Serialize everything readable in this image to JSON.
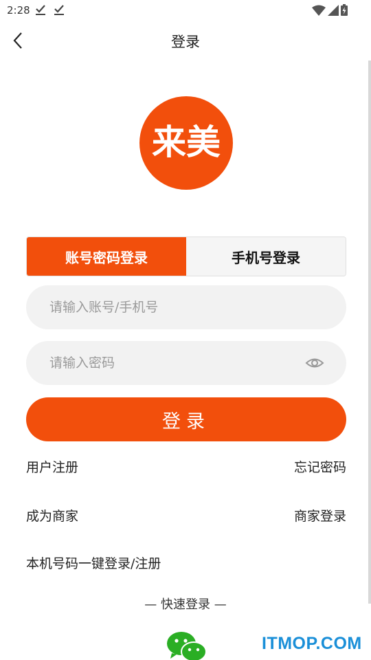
{
  "status_bar": {
    "time": "2:28",
    "icons": [
      "download-done-icon",
      "download-done-icon",
      "wifi-icon",
      "signal-icon",
      "battery-charging-icon"
    ]
  },
  "header": {
    "title": "登录",
    "back_icon": "chevron-left-icon"
  },
  "logo": {
    "text": "来美",
    "color": "#f24f0c"
  },
  "tabs": [
    {
      "label": "账号密码登录",
      "active": true
    },
    {
      "label": "手机号登录",
      "active": false
    }
  ],
  "form": {
    "account": {
      "placeholder": "请输入账号/手机号",
      "value": ""
    },
    "password": {
      "placeholder": "请输入密码",
      "value": "",
      "toggle_icon": "eye-icon"
    },
    "submit_label": "登录"
  },
  "links": {
    "register": "用户注册",
    "forgot_password": "忘记密码",
    "become_merchant": "成为商家",
    "merchant_login": "商家登录",
    "one_click_login": "本机号码一键登录/注册"
  },
  "quick_login": {
    "title": "— 快速登录 —",
    "providers": [
      "wechat-icon"
    ]
  },
  "watermark": "ITMOP.COM",
  "colors": {
    "accent": "#f24f0c",
    "input_bg": "#f2f2f2",
    "wechat_green": "#2aae24",
    "watermark_blue": "#1a8fd8"
  }
}
